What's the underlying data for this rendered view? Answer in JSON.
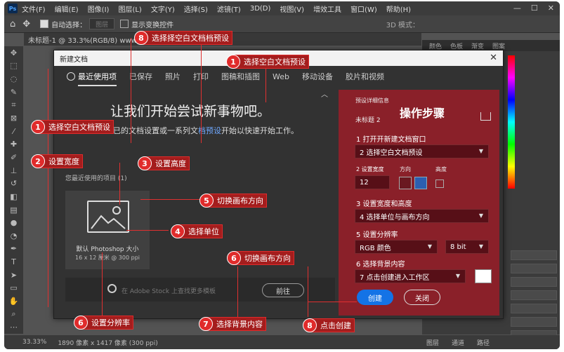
{
  "menubar": {
    "app_icon": "Ps",
    "items": [
      "文件(F)",
      "编辑(E)",
      "图像(I)",
      "图层(L)",
      "文字(Y)",
      "选择(S)",
      "滤镜(T)",
      "3D(D)",
      "视图(V)",
      "增效工具",
      "窗口(W)",
      "帮助(H)"
    ]
  },
  "options_bar": {
    "auto_select": "自动选择：",
    "auto_select_value": "图层",
    "show_transform": "显示变换控件",
    "mode_3d": "3D 模式："
  },
  "document_tab": "未标题-1 @ 33.3%(RGB/8) www.uzzf.com 激活",
  "status_bar": {
    "zoom": "33.33%",
    "info": "1890 像素 x 1417 像素 (300 ppi)"
  },
  "right_panel": {
    "tabs": [
      "颜色",
      "色板",
      "渐变",
      "图案"
    ],
    "bottom_tabs": [
      "图层",
      "通道",
      "路径"
    ]
  },
  "dialog": {
    "title": "新建文档",
    "tabs": [
      "最近使用项",
      "已保存",
      "照片",
      "打印",
      "图稿和插图",
      "Web",
      "移动设备",
      "胶片和视频"
    ],
    "headline": "让我们开始尝试新事物吧。",
    "subline_pre": "已的文档设置或一系列文",
    "subline_link": "档预设",
    "subline_post": "开始以快速开始工作。",
    "recent_label": "您最近使用的项目 (1)",
    "preset_name": "默认 Photoshop 大小",
    "preset_size": "16 x 12 厘米 @ 300 ppi",
    "stock_placeholder": "在 Adobe Stock 上查找更多模板",
    "go_button": "前往",
    "preset_details_label": "预设详细信息",
    "doc_name": "未标题 2",
    "panel_title": "操作步骤",
    "step1": "1 打开开新建文档窗口",
    "select1": "2 选择空白文档预设",
    "step2": "2 设置宽度",
    "orientation_label": "方向",
    "height_label": "高度",
    "width_value": "12",
    "step3": "3 设置宽度和高度",
    "select3": "4 选择单位与画布方向",
    "step5": "5 设置分辨率",
    "color_mode": "RGB 颜色",
    "bit_depth": "8 bit",
    "step6": "6 选择背景内容",
    "select6": "7 点击创建进入工作区",
    "create_button": "创建",
    "close_button": "关闭"
  },
  "callouts": [
    {
      "num": "8",
      "text": "选择择空白文档档预设"
    },
    {
      "num": "1",
      "text": "选择空白文档预设"
    },
    {
      "num": "1",
      "text": "选择空白文档预设"
    },
    {
      "num": "2",
      "text": "设置宽度"
    },
    {
      "num": "3",
      "text": "设置高度"
    },
    {
      "num": "5",
      "text": "切换画布方向"
    },
    {
      "num": "4",
      "text": "选择单位"
    },
    {
      "num": "6",
      "text": "切换画布方向"
    },
    {
      "num": "6",
      "text": "设置分辨率"
    },
    {
      "num": "7",
      "text": "选择背景内容"
    },
    {
      "num": "8",
      "text": "点击创建"
    }
  ],
  "colors": {
    "accent": "#e02b2b",
    "panel_red": "#961e28",
    "create_blue": "#1473e6"
  }
}
